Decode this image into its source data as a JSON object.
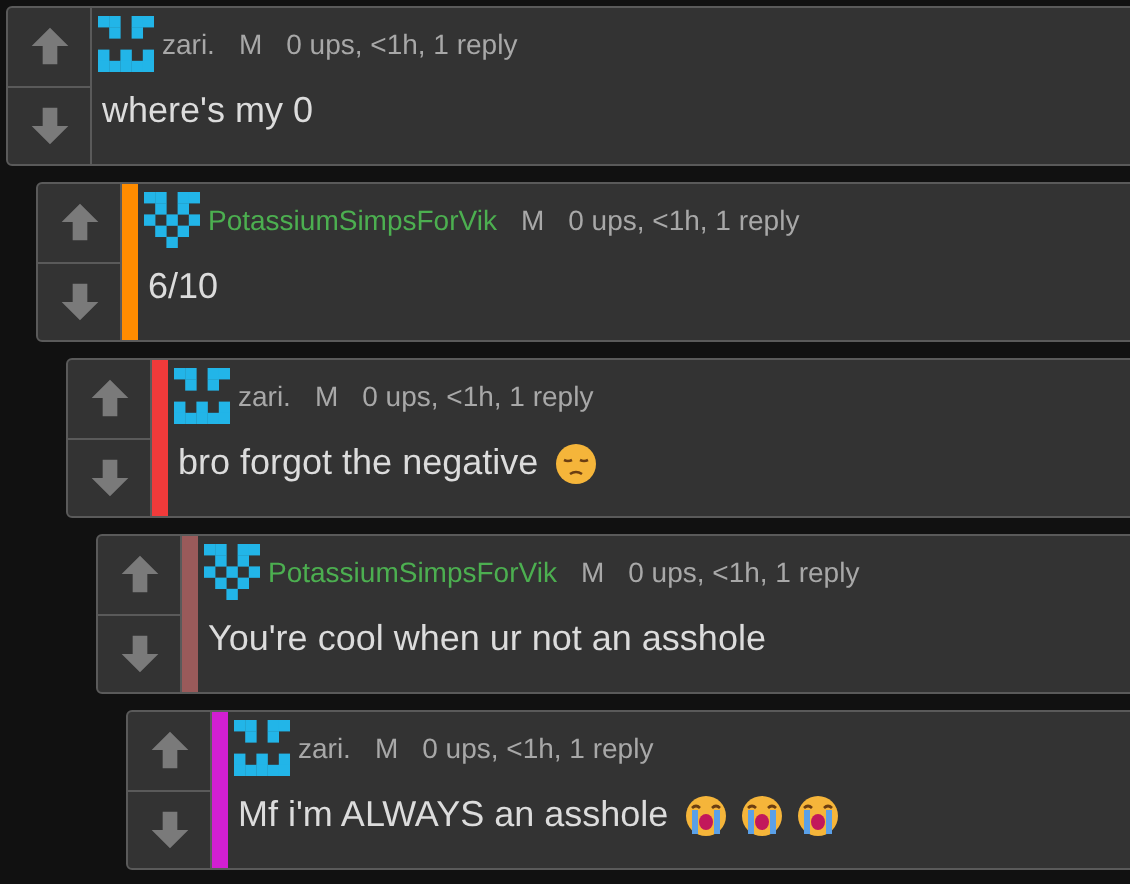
{
  "comments": [
    {
      "kind": "castle",
      "user": {
        "name": "zari.",
        "color": "#a8a8a8"
      },
      "badge": "M",
      "meta": "0 ups, <1h, 1 reply",
      "text": "where's my 0",
      "children": [
        {
          "kind": "heart",
          "user": {
            "name": "PotassiumSimpsForVik",
            "color": "#4caf50"
          },
          "badge": "M",
          "meta": "0 ups, <1h, 1 reply",
          "text": "6/10",
          "color": "#ff8c00",
          "children": [
            {
              "kind": "castle",
              "user": {
                "name": "zari.",
                "color": "#a8a8a8"
              },
              "badge": "M",
              "meta": "0 ups, <1h, 1 reply",
              "text": "bro forgot the negative",
              "emojis": [
                {
                  "kind": "pensive"
                }
              ],
              "color": "#f03a3a",
              "children": [
                {
                  "kind": "heart",
                  "user": {
                    "name": "PotassiumSimpsForVik",
                    "color": "#4caf50"
                  },
                  "badge": "M",
                  "meta": "0 ups, <1h, 1 reply",
                  "text": "You're cool when ur not an asshole",
                  "color": "#9a5a5a",
                  "children": [
                    {
                      "kind": "castle",
                      "user": {
                        "name": "zari.",
                        "color": "#a8a8a8"
                      },
                      "badge": "M",
                      "meta": "0 ups, <1h, 1 reply",
                      "text": "Mf i'm ALWAYS an asshole",
                      "emojis": [
                        {
                          "kind": "crying"
                        },
                        {
                          "kind": "crying"
                        },
                        {
                          "kind": "crying"
                        }
                      ],
                      "color": "#d21fd2"
                    }
                  ]
                }
              ]
            }
          ]
        }
      ]
    }
  ]
}
